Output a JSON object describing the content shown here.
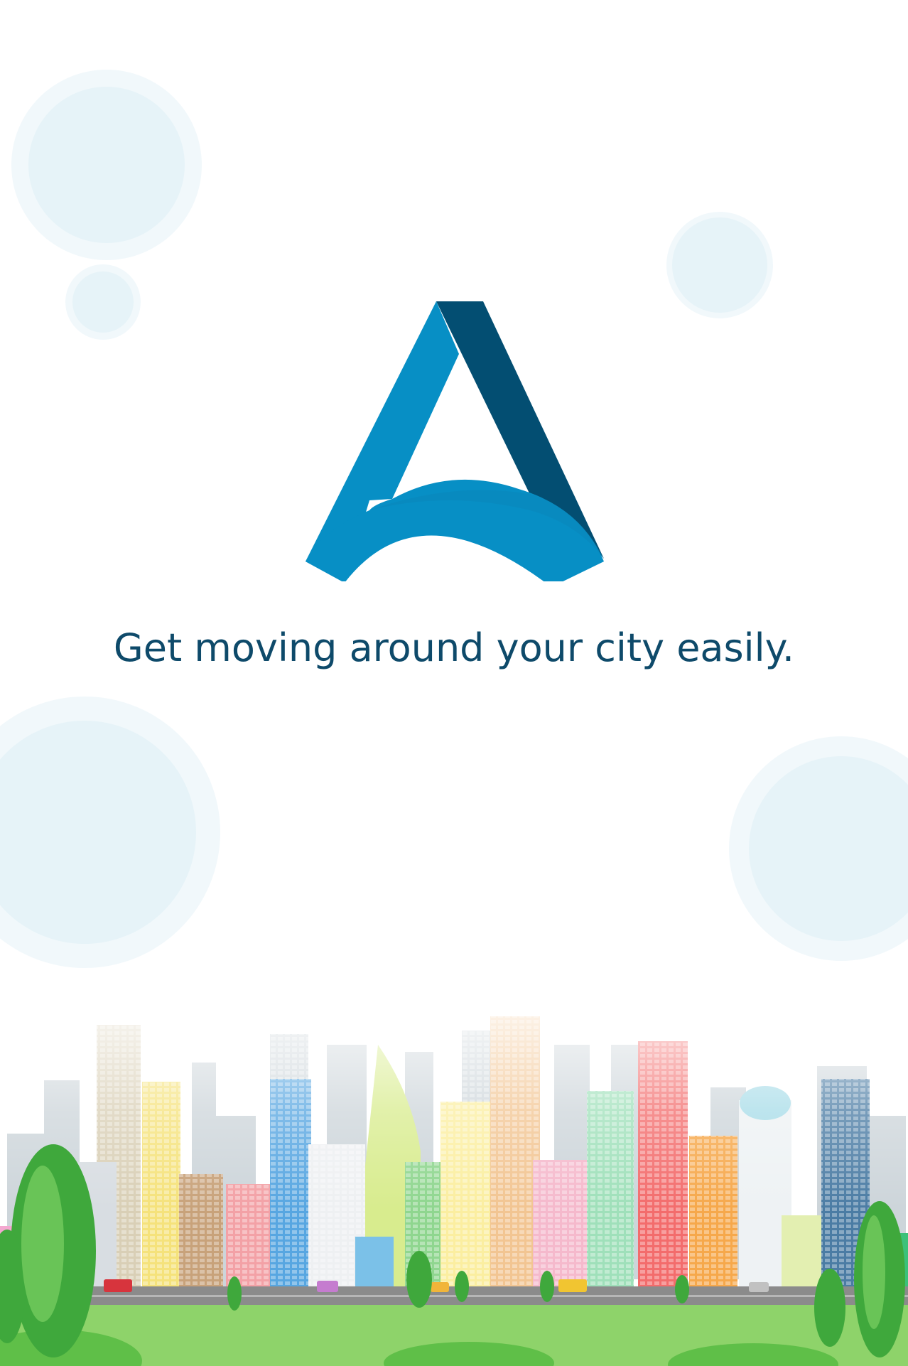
{
  "app": {
    "screen": "splash",
    "logo_icon": "a-arch-logo-icon"
  },
  "tagline": "Get moving around your city easily.",
  "colors": {
    "tagline": "#0e4a6a",
    "logo_light": "#078fc5",
    "logo_dark": "#034e72",
    "bubble": "#e6f3f8",
    "grass": "#8ed36a",
    "road": "#8b8b8b"
  },
  "illustration": {
    "name": "city-skyline-illustration"
  }
}
